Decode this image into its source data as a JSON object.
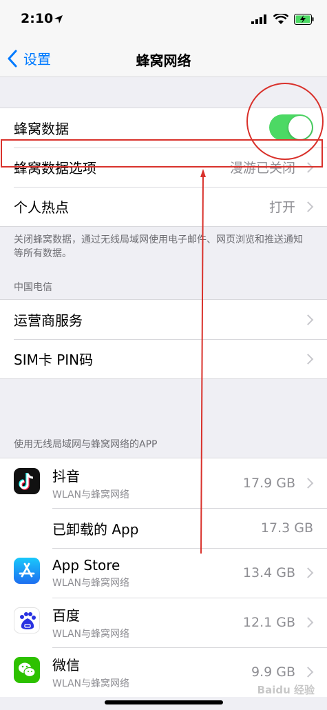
{
  "status": {
    "time": "2:10"
  },
  "nav": {
    "back_label": "设置",
    "title": "蜂窝网络"
  },
  "group1": {
    "cellular_data": {
      "label": "蜂窝数据",
      "enabled": true
    },
    "cellular_options": {
      "label": "蜂窝数据选项",
      "value": "漫游已关闭"
    },
    "hotspot": {
      "label": "个人热点",
      "value": "打开"
    }
  },
  "footnote": "关闭蜂窝数据，通过无线局域网使用电子邮件、网页浏览和推送通知等所有数据。",
  "carrier": {
    "header": "中国电信",
    "items": [
      {
        "label": "运营商服务"
      },
      {
        "label": "SIM卡 PIN码"
      }
    ]
  },
  "apps": {
    "header": "使用无线局域网与蜂窝网络的APP",
    "items": [
      {
        "name": "抖音",
        "sub": "WLAN与蜂窝网络",
        "size": "17.9 GB",
        "icon": "douyin-icon"
      },
      {
        "name": "已卸载的 App",
        "sub": "",
        "size": "17.3 GB",
        "icon": ""
      },
      {
        "name": "App Store",
        "sub": "WLAN与蜂窝网络",
        "size": "13.4 GB",
        "icon": "app-store-icon"
      },
      {
        "name": "百度",
        "sub": "WLAN与蜂窝网络",
        "size": "12.1 GB",
        "icon": "baidu-icon"
      },
      {
        "name": "微信",
        "sub": "WLAN与蜂窝网络",
        "size": "9.9 GB",
        "icon": "wechat-icon"
      }
    ]
  },
  "watermark": "Baidu 经验",
  "colors": {
    "accent": "#007aff",
    "toggle_on": "#4cd964",
    "annotation": "#d9312b"
  }
}
